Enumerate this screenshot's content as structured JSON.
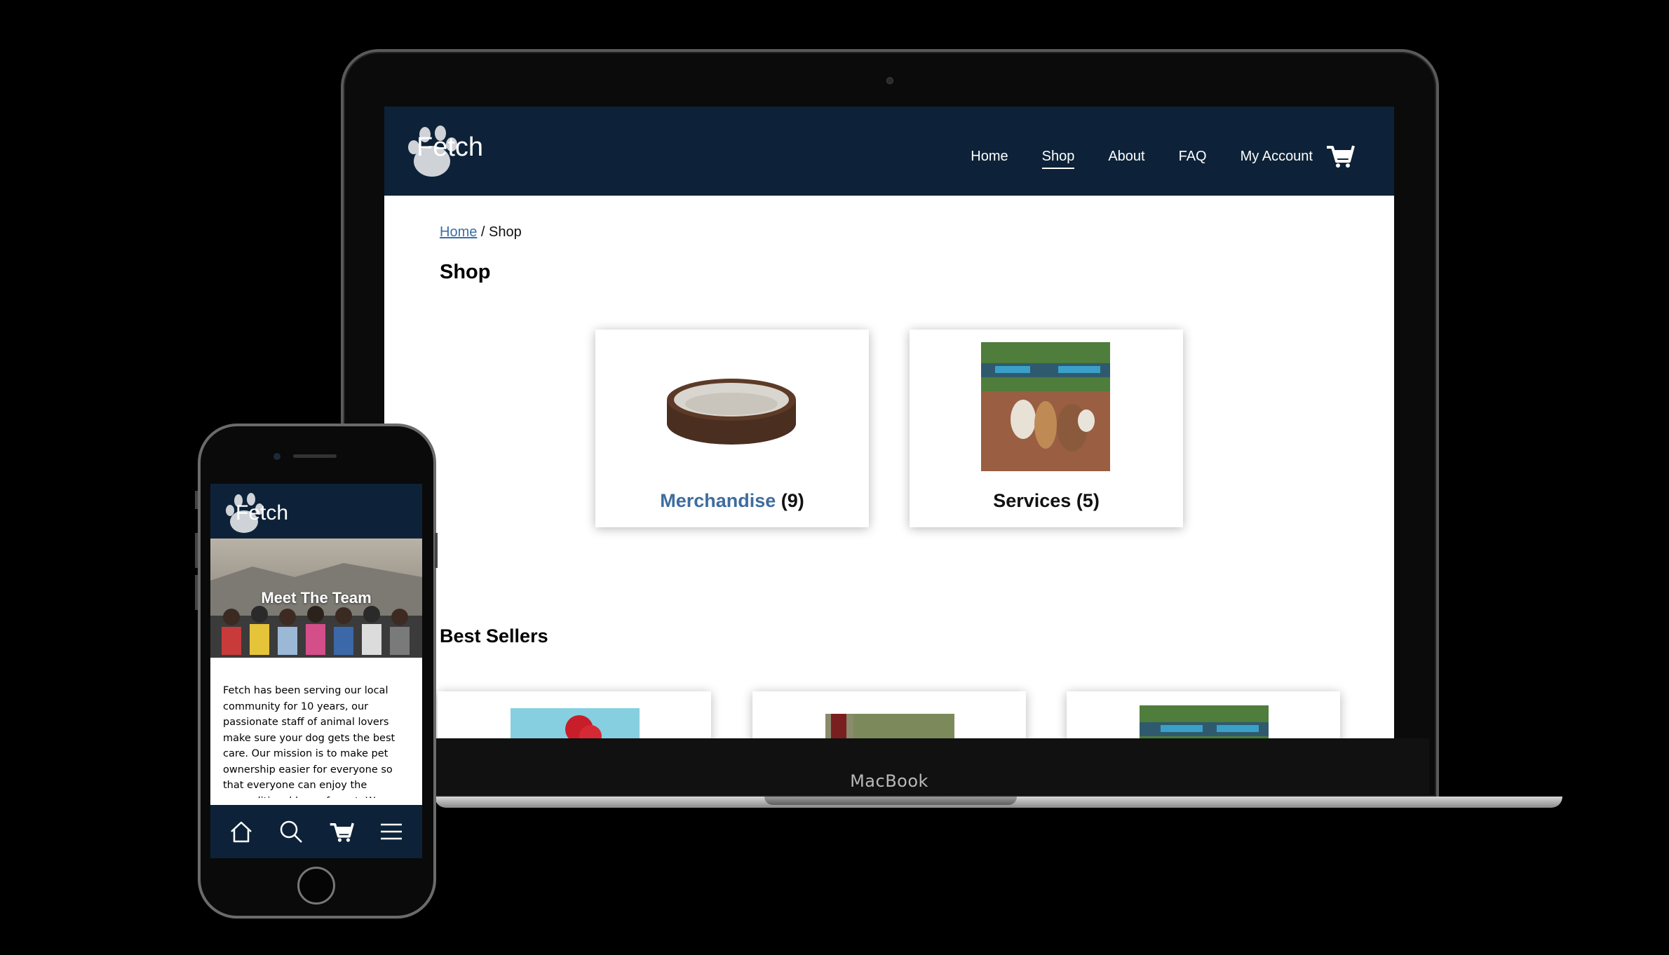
{
  "laptop": {
    "brand": "MacBook",
    "site": {
      "logo_text": "Fetch",
      "nav": [
        {
          "label": "Home",
          "active": false
        },
        {
          "label": "Shop",
          "active": true
        },
        {
          "label": "About",
          "active": false
        },
        {
          "label": "FAQ",
          "active": false
        },
        {
          "label": "My Account",
          "active": false
        }
      ],
      "breadcrumb": {
        "home": "Home",
        "separator": " / ",
        "current": "Shop"
      },
      "page_title": "Shop",
      "categories": [
        {
          "name": "Merchandise",
          "count": "(9)"
        },
        {
          "name": "Services",
          "count": "(5)"
        }
      ],
      "best_sellers_title": "Best Sellers"
    }
  },
  "phone": {
    "logo_text": "Fetch",
    "hero_title": "Meet The Team",
    "body_text": "Fetch has been serving our local community for 10 years, our passionate staff of animal lovers make sure your dog gets the best care. Our mission is to make pet ownership easier for everyone so that everyone can enjoy the unconditional love of a pet. We",
    "tabs": [
      "home-icon",
      "search-icon",
      "cart-icon",
      "menu-icon"
    ]
  },
  "colors": {
    "header_navy": "#0d2238",
    "link_blue": "#3d6d9e"
  }
}
